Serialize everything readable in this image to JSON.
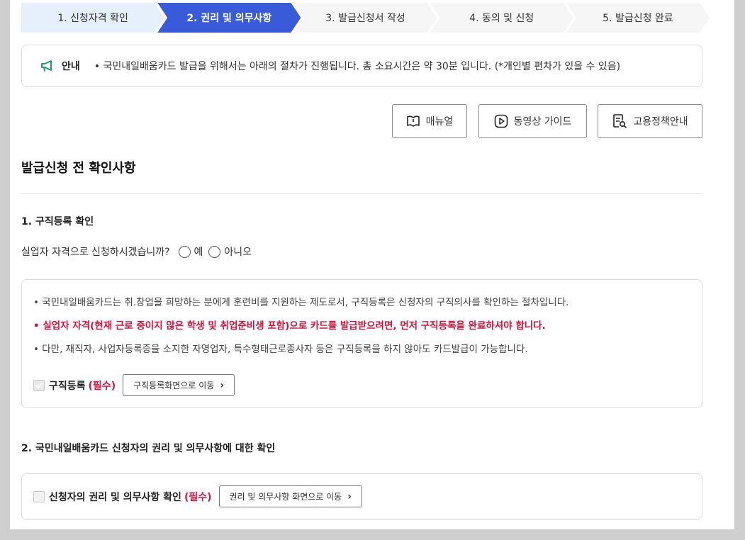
{
  "steps": [
    {
      "label": "1. 신청자격 확인",
      "state": "done"
    },
    {
      "label": "2. 권리 및 의무사항",
      "state": "active"
    },
    {
      "label": "3. 발급신청서 작성",
      "state": "todo"
    },
    {
      "label": "4. 동의 및 신청",
      "state": "todo"
    },
    {
      "label": "5. 발급신청 완료",
      "state": "todo"
    }
  ],
  "notice": {
    "icon": "megaphone-icon",
    "label": "안내",
    "text": "• 국민내일배움카드 발급을 위해서는 아래의 절차가 진행됩니다. 총 소요시간은 약 30분 입니다. (*개인별 편차가 있을 수 있음)"
  },
  "guide_buttons": {
    "manual": "매뉴얼",
    "video": "동영상 가이드",
    "policy": "고용정책안내"
  },
  "section_title": "발급신청 전 확인사항",
  "section1": {
    "title": "1. 구직등록 확인",
    "question": "실업자 자격으로 신청하시겠습니까?",
    "options": [
      "예",
      "아니오"
    ],
    "bullets": [
      "• 국민내일배움카드는 취.창업을 희망하는 분에게 훈련비를 지원하는 제도로서, 구직등록은 신청자의 구직의사를 확인하는 절차입니다.",
      "• 실업자 자격(현재 근로 중이지 않은 학생 및 취업준비생 포함)으로 카드를 발급받으려면, 먼저 구직등록을 완료하셔야 합니다.",
      "• 다만, 재직자, 사업자등록증을 소지한 자영업자, 특수형태근로종사자 등은 구직등록을 하지 않아도 카드발급이 가능합니다."
    ],
    "check_label": "구직등록",
    "required": "(필수)",
    "button": "구직등록화면으로 이동"
  },
  "section2": {
    "title": "2. 국민내일배움카드 신청자의 권리 및 의무사항에 대한 확인",
    "check_label": "신청자의 권리 및 의무사항 확인",
    "required": "(필수)",
    "button": "권리 및 의무사항 화면으로 이동"
  },
  "colors": {
    "active_step": "#3a5bd9",
    "done_step": "#e6effc",
    "required_red": "#d6123a"
  }
}
